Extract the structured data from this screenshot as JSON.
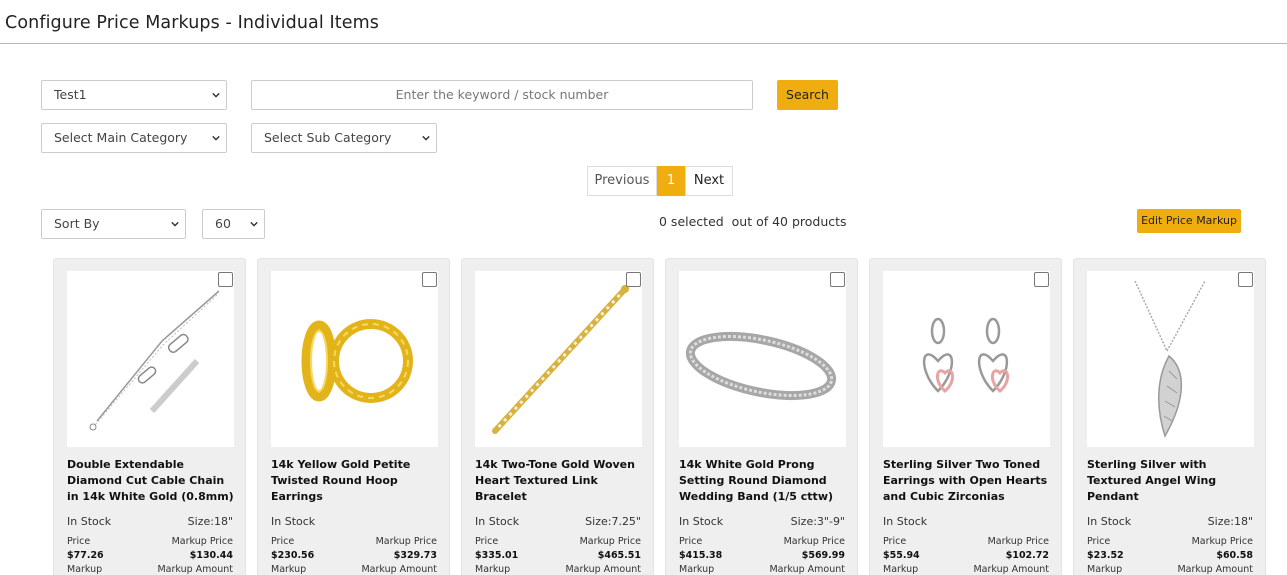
{
  "page": {
    "title": "Configure Price Markups - Individual Items"
  },
  "filters": {
    "store_select": "Test1",
    "search_placeholder": "Enter the keyword / stock number",
    "search_button": "Search",
    "main_category": "Select Main Category",
    "sub_category": "Select Sub Category",
    "sort_by": "Sort By",
    "page_size": "60"
  },
  "pagination": {
    "previous": "Previous",
    "current": "1",
    "next": "Next"
  },
  "selection": {
    "status": "0 selected  out of 40 products",
    "edit_button": "Edit Price Markup"
  },
  "colors": {
    "accent": "#f0ad10",
    "header_rule": "#f0b814",
    "card_bg": "#efefef"
  },
  "labels": {
    "in_stock": "In Stock",
    "price": "Price",
    "markup_price": "Markup Price",
    "markup": "Markup",
    "markup_amount": "Markup Amount"
  },
  "products": [
    {
      "name": "Double Extendable Diamond Cut Cable Chain in 14k White Gold (0.8mm)",
      "size": "Size:18\"",
      "price": "$77.26",
      "markup_price": "$130.44",
      "image": "chain-icon"
    },
    {
      "name": "14k Yellow Gold Petite Twisted Round Hoop Earrings",
      "size": "",
      "price": "$230.56",
      "markup_price": "$329.73",
      "image": "hoop-earrings-icon"
    },
    {
      "name": "14k Two-Tone Gold Woven Heart Textured Link Bracelet",
      "size": "Size:7.25\"",
      "price": "$335.01",
      "markup_price": "$465.51",
      "image": "bracelet-icon"
    },
    {
      "name": "14k White Gold Prong Setting Round Diamond Wedding Band (1/5 cttw)",
      "size": "Size:3\"-9\"",
      "price": "$415.38",
      "markup_price": "$569.99",
      "image": "ring-icon"
    },
    {
      "name": "Sterling Silver Two Toned Earrings with Open Hearts and Cubic Zirconias",
      "size": "",
      "price": "$55.94",
      "markup_price": "$102.72",
      "image": "heart-earrings-icon"
    },
    {
      "name": "Sterling Silver with Textured Angel Wing Pendant",
      "size": "Size:18\"",
      "price": "$23.52",
      "markup_price": "$60.58",
      "image": "wing-pendant-icon"
    }
  ]
}
